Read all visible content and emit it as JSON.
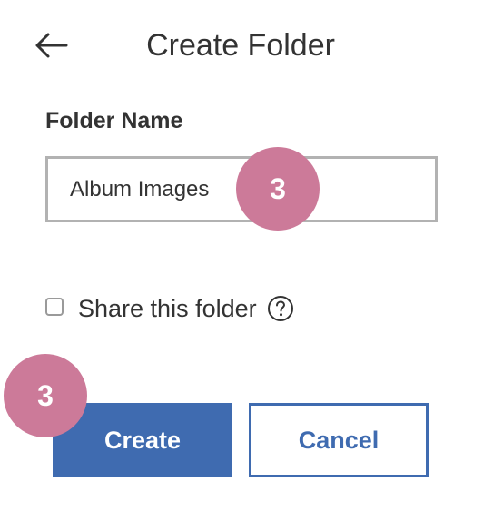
{
  "header": {
    "title": "Create Folder",
    "back_icon": "arrow-left-icon"
  },
  "form": {
    "folder_name_label": "Folder Name",
    "folder_name_value": "Album Images",
    "share_label": "Share this folder",
    "share_checked": false,
    "help_icon": "question-circle-icon"
  },
  "steps": {
    "input_step": "3",
    "create_step": "3"
  },
  "buttons": {
    "create_label": "Create",
    "cancel_label": "Cancel"
  },
  "colors": {
    "primary": "#3f6bb0",
    "badge": "#cc7a99",
    "text": "#333333",
    "input_border": "#b2b2b2"
  }
}
